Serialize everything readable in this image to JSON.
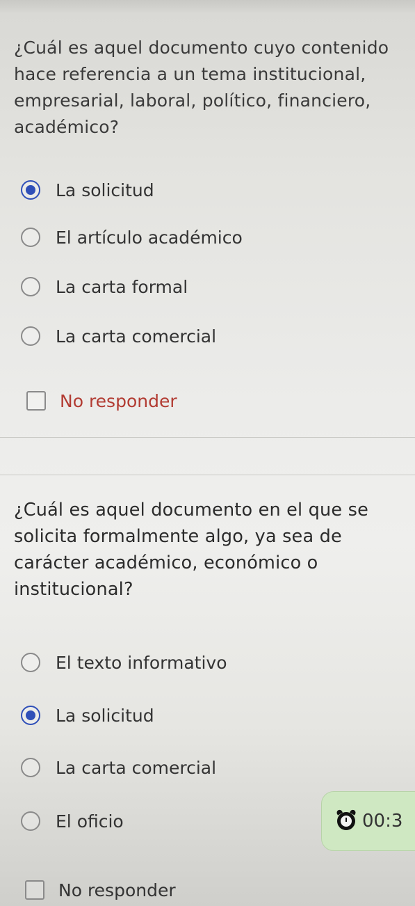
{
  "questions": [
    {
      "text": "¿Cuál es aquel documento cuyo contenido hace referencia a un tema institucional, empresarial, laboral, político, financiero, académico?",
      "options": [
        {
          "label": "La solicitud",
          "selected": true
        },
        {
          "label": "El artículo académico",
          "selected": false
        },
        {
          "label": "La carta formal",
          "selected": false
        },
        {
          "label": "La carta comercial",
          "selected": false
        }
      ],
      "no_answer_label": "No responder"
    },
    {
      "text": "¿Cuál es aquel documento en el que se solicita formalmente algo, ya sea de carácter académico, económico o institucional?",
      "options": [
        {
          "label": "El texto informativo",
          "selected": false
        },
        {
          "label": "La solicitud",
          "selected": true
        },
        {
          "label": "La carta comercial",
          "selected": false
        },
        {
          "label": "El oficio",
          "selected": false
        }
      ],
      "no_answer_label": "No responder"
    }
  ],
  "timer": {
    "icon": "alarm-clock-icon",
    "text": "00:3"
  },
  "colors": {
    "accent": "#2f4fb8",
    "no_answer": "#b23b32",
    "timer_bg": "#cfe8c2"
  }
}
